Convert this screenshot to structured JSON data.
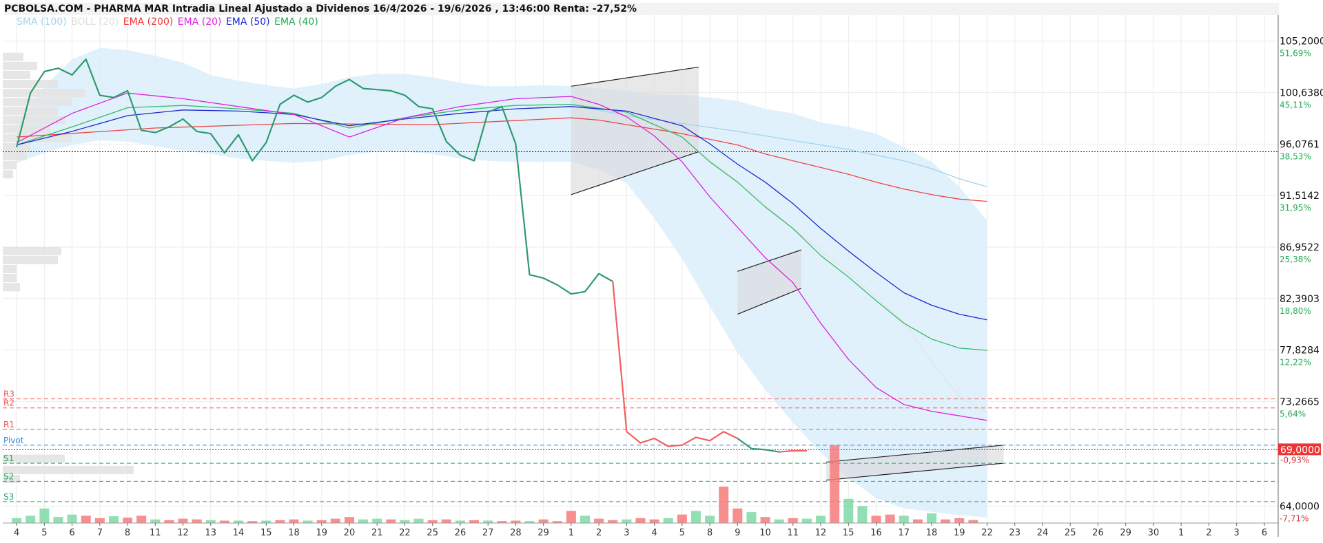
{
  "title": "PCBOLSA.COM - PHARMA MAR Intradia Lineal Ajustado a Dividenos 16/4/2026 - 19/6/2026 , 13:46:00 Renta: -27,52%",
  "legend": [
    {
      "label": "SMA (100)",
      "color": "#9fd3f0"
    },
    {
      "label": "BOLL (20)",
      "color": "#dddddd"
    },
    {
      "label": "EMA (200)",
      "color": "#ee3333"
    },
    {
      "label": "EMA (20)",
      "color": "#dd22dd"
    },
    {
      "label": "EMA (50)",
      "color": "#1a2ad0"
    },
    {
      "label": "EMA (40)",
      "color": "#22aa55"
    }
  ],
  "chart_data": {
    "type": "line",
    "ylim": [
      62.5,
      107.5
    ],
    "y_ticks": [
      {
        "value": 105.2,
        "price": "105,2000",
        "pct": "51,69%"
      },
      {
        "value": 100.638,
        "price": "100,6380",
        "pct": "45,11%"
      },
      {
        "value": 96.0761,
        "price": "96,0761",
        "pct": "38,53%"
      },
      {
        "value": 91.5142,
        "price": "91,5142",
        "pct": "31,95%"
      },
      {
        "value": 86.9522,
        "price": "86,9522",
        "pct": "25,38%"
      },
      {
        "value": 82.3903,
        "price": "82,3903",
        "pct": "18,80%"
      },
      {
        "value": 77.8284,
        "price": "77,8284",
        "pct": "12,22%"
      },
      {
        "value": 73.2665,
        "price": "73,2665",
        "pct": "5,64%"
      },
      {
        "value": 64.0,
        "price": "64,0000",
        "pct": "-7,71%"
      }
    ],
    "x_labels": [
      "4",
      "5",
      "6",
      "7",
      "8",
      "11",
      "12",
      "13",
      "14",
      "15",
      "18",
      "19",
      "20",
      "21",
      "22",
      "25",
      "26",
      "27",
      "28",
      "29",
      "1",
      "2",
      "3",
      "4",
      "5",
      "8",
      "9",
      "10",
      "11",
      "12",
      "15",
      "16",
      "17",
      "18",
      "19",
      "22",
      "23",
      "24",
      "25",
      "26",
      "29",
      "30",
      "1",
      "2",
      "3",
      "6"
    ],
    "last_price": {
      "value": 69.0,
      "label": "69,0000",
      "pct": "-0,93%"
    },
    "reference_line": 95.4,
    "pivot_levels": [
      {
        "name": "R3",
        "value": 73.5,
        "color": "#ee5555"
      },
      {
        "name": "R2",
        "value": 72.7,
        "color": "#ee5555"
      },
      {
        "name": "R1",
        "value": 70.8,
        "color": "#ee5555"
      },
      {
        "name": "Pivot",
        "value": 69.4,
        "color": "#3388dd"
      },
      {
        "name": "S1",
        "value": 67.8,
        "color": "#22aa66"
      },
      {
        "name": "S2",
        "value": 66.2,
        "color": "#22aa66"
      },
      {
        "name": "S3",
        "value": 64.4,
        "color": "#22aa66"
      }
    ],
    "series": [
      {
        "key": "price",
        "x": [
          0,
          0.5,
          1,
          1.5,
          2,
          2.5,
          3,
          3.5,
          4,
          4.5,
          5,
          5.5,
          6,
          6.5,
          7,
          7.5,
          8,
          8.5,
          9,
          9.5,
          10,
          10.5,
          11,
          11.5,
          12,
          12.5,
          13,
          13.5,
          14,
          14.5,
          15,
          15.5,
          16,
          16.5,
          17,
          17.5,
          18,
          18.5,
          19,
          19.5,
          20,
          20.5,
          21,
          21.5,
          22,
          22.5,
          23,
          23.5,
          24,
          24.5,
          25,
          25.5,
          26,
          26.5,
          27,
          27.5,
          28,
          28.5,
          29,
          29.5,
          30,
          30.5,
          31,
          31.5,
          32,
          32.5,
          33,
          33.5,
          34,
          34.5,
          35
        ],
        "values": [
          95.8,
          100.6,
          102.5,
          102.8,
          102.2,
          103.6,
          100.4,
          100.2,
          100.8,
          97.3,
          97.1,
          97.6,
          98.3,
          97.2,
          97.0,
          95.3,
          96.9,
          94.6,
          96.2,
          99.6,
          100.4,
          99.8,
          100.2,
          101.2,
          101.8,
          101.0,
          100.9,
          100.8,
          100.4,
          99.4,
          99.2,
          96.3,
          95.1,
          94.6,
          98.9,
          99.4,
          96.1,
          84.5,
          84.2,
          83.6,
          82.8,
          83.0,
          84.6,
          83.9,
          70.6,
          69.6,
          70.0,
          69.3,
          69.4,
          70.1,
          69.8,
          70.6,
          70.0,
          69.1,
          69.0,
          68.8,
          68.9,
          68.9,
          69.0,
          69.0,
          69.0,
          69.0,
          69.0,
          69.0,
          69.0,
          69.0,
          69.0,
          69.0,
          69.0,
          69.0,
          69.0
        ]
      },
      {
        "key": "ema200",
        "x": [
          0,
          5,
          10,
          15,
          20,
          21,
          22,
          23,
          24,
          25,
          26,
          27,
          28,
          29,
          30,
          31,
          32,
          33,
          34,
          35
        ],
        "values": [
          96.7,
          97.5,
          97.9,
          97.8,
          98.4,
          98.2,
          97.8,
          97.4,
          97.0,
          96.5,
          96.0,
          95.2,
          94.6,
          94.0,
          93.4,
          92.7,
          92.1,
          91.6,
          91.2,
          91.0
        ]
      },
      {
        "key": "ema20",
        "x": [
          0,
          2,
          4,
          6,
          8,
          10,
          12,
          14,
          16,
          18,
          20,
          21,
          22,
          23,
          24,
          25,
          26,
          27,
          28,
          29,
          30,
          31,
          32,
          33,
          34,
          35
        ],
        "values": [
          96.2,
          98.8,
          100.6,
          100.1,
          99.4,
          98.7,
          96.7,
          98.4,
          99.4,
          100.1,
          100.3,
          99.6,
          98.5,
          96.8,
          94.5,
          91.4,
          88.7,
          86.0,
          83.8,
          80.2,
          77.0,
          74.5,
          73.0,
          72.4,
          72.0,
          71.6
        ]
      },
      {
        "key": "ema40",
        "x": [
          0,
          2,
          4,
          6,
          8,
          10,
          12,
          14,
          16,
          18,
          20,
          22,
          24,
          25,
          26,
          27,
          28,
          29,
          30,
          31,
          32,
          33,
          34,
          35
        ],
        "values": [
          96.0,
          97.6,
          99.3,
          99.5,
          99.2,
          98.8,
          97.5,
          98.4,
          99.1,
          99.5,
          99.6,
          98.9,
          96.7,
          94.5,
          92.7,
          90.5,
          88.6,
          86.2,
          84.3,
          82.2,
          80.2,
          78.8,
          78.0,
          77.8
        ]
      },
      {
        "key": "ema50",
        "x": [
          0,
          2,
          4,
          6,
          8,
          10,
          12,
          14,
          16,
          18,
          20,
          22,
          24,
          25,
          26,
          27,
          28,
          29,
          30,
          31,
          32,
          33,
          34,
          35
        ],
        "values": [
          96.0,
          97.2,
          98.6,
          99.1,
          99.0,
          98.7,
          97.7,
          98.3,
          98.8,
          99.2,
          99.4,
          99.0,
          97.7,
          96.1,
          94.3,
          92.7,
          90.8,
          88.6,
          86.6,
          84.7,
          82.9,
          81.8,
          81.0,
          80.5
        ]
      },
      {
        "key": "sma100",
        "x": [
          20,
          22,
          24,
          26,
          28,
          30,
          32,
          33,
          34,
          35
        ],
        "values": [
          99.6,
          98.6,
          97.9,
          97.2,
          96.4,
          95.6,
          94.6,
          93.9,
          93.0,
          92.3
        ]
      },
      {
        "key": "boll_mid",
        "x": [
          20,
          22,
          24,
          26,
          28,
          30,
          32,
          33,
          34,
          35
        ],
        "values": [
          99.9,
          99.0,
          96.6,
          92.8,
          88.6,
          84.7,
          80.3,
          76.8,
          73.7,
          72.3
        ]
      },
      {
        "key": "boll_upper",
        "x": [
          0,
          1,
          2,
          3,
          4,
          5,
          6,
          7,
          8,
          9,
          10,
          11,
          12,
          13,
          14,
          15,
          16,
          17,
          18,
          19,
          20,
          21,
          22,
          23,
          24,
          25,
          26,
          27,
          28,
          29,
          30,
          31,
          32,
          33,
          34,
          35
        ],
        "values": [
          97.5,
          101.2,
          103.6,
          104.6,
          104.4,
          103.9,
          103.3,
          102.2,
          101.7,
          101.3,
          101.0,
          101.4,
          102.0,
          102.3,
          102.3,
          102.0,
          101.5,
          101.2,
          101.2,
          101.3,
          101.2,
          101.0,
          100.8,
          100.5,
          100.4,
          100.2,
          99.9,
          99.2,
          98.8,
          98.0,
          97.6,
          97.0,
          95.8,
          94.5,
          92.3,
          89.3
        ]
      },
      {
        "key": "boll_lower",
        "x": [
          0,
          1,
          2,
          3,
          4,
          5,
          6,
          7,
          8,
          9,
          10,
          11,
          12,
          13,
          14,
          15,
          16,
          17,
          18,
          19,
          20,
          21,
          22,
          23,
          24,
          25,
          26,
          27,
          28,
          29,
          30,
          31,
          32,
          33,
          34,
          35
        ],
        "values": [
          94.4,
          95.3,
          96.0,
          96.4,
          96.3,
          95.9,
          95.5,
          95.2,
          94.8,
          94.6,
          94.4,
          94.6,
          95.1,
          95.4,
          95.4,
          95.2,
          94.8,
          94.6,
          94.5,
          94.5,
          94.5,
          93.8,
          92.6,
          89.5,
          85.9,
          81.7,
          77.6,
          74.3,
          71.4,
          68.7,
          66.5,
          64.7,
          63.8,
          63.5,
          63.2,
          63.0
        ]
      }
    ],
    "volumes": [
      {
        "x": 0,
        "v": 0.2,
        "c": "g"
      },
      {
        "x": 0.5,
        "v": 0.3,
        "c": "g"
      },
      {
        "x": 1,
        "v": 0.6,
        "c": "g"
      },
      {
        "x": 1.5,
        "v": 0.25,
        "c": "g"
      },
      {
        "x": 2,
        "v": 0.35,
        "c": "g"
      },
      {
        "x": 2.5,
        "v": 0.3,
        "c": "r"
      },
      {
        "x": 3,
        "v": 0.2,
        "c": "r"
      },
      {
        "x": 3.5,
        "v": 0.28,
        "c": "g"
      },
      {
        "x": 4,
        "v": 0.22,
        "c": "r"
      },
      {
        "x": 4.5,
        "v": 0.3,
        "c": "r"
      },
      {
        "x": 5,
        "v": 0.15,
        "c": "g"
      },
      {
        "x": 5.5,
        "v": 0.12,
        "c": "r"
      },
      {
        "x": 6,
        "v": 0.18,
        "c": "r"
      },
      {
        "x": 6.5,
        "v": 0.15,
        "c": "r"
      },
      {
        "x": 7,
        "v": 0.12,
        "c": "g"
      },
      {
        "x": 7.5,
        "v": 0.1,
        "c": "r"
      },
      {
        "x": 8,
        "v": 0.1,
        "c": "g"
      },
      {
        "x": 8.5,
        "v": 0.08,
        "c": "r"
      },
      {
        "x": 9,
        "v": 0.1,
        "c": "g"
      },
      {
        "x": 9.5,
        "v": 0.12,
        "c": "r"
      },
      {
        "x": 10,
        "v": 0.15,
        "c": "r"
      },
      {
        "x": 10.5,
        "v": 0.1,
        "c": "g"
      },
      {
        "x": 11,
        "v": 0.12,
        "c": "r"
      },
      {
        "x": 11.5,
        "v": 0.18,
        "c": "r"
      },
      {
        "x": 12,
        "v": 0.25,
        "c": "r"
      },
      {
        "x": 12.5,
        "v": 0.15,
        "c": "g"
      },
      {
        "x": 13,
        "v": 0.18,
        "c": "g"
      },
      {
        "x": 13.5,
        "v": 0.15,
        "c": "r"
      },
      {
        "x": 14,
        "v": 0.12,
        "c": "g"
      },
      {
        "x": 14.5,
        "v": 0.18,
        "c": "g"
      },
      {
        "x": 15,
        "v": 0.12,
        "c": "r"
      },
      {
        "x": 15.5,
        "v": 0.15,
        "c": "r"
      },
      {
        "x": 16,
        "v": 0.1,
        "c": "g"
      },
      {
        "x": 16.5,
        "v": 0.12,
        "c": "r"
      },
      {
        "x": 17,
        "v": 0.1,
        "c": "g"
      },
      {
        "x": 17.5,
        "v": 0.08,
        "c": "r"
      },
      {
        "x": 18,
        "v": 0.1,
        "c": "r"
      },
      {
        "x": 18.5,
        "v": 0.08,
        "c": "g"
      },
      {
        "x": 19,
        "v": 0.15,
        "c": "r"
      },
      {
        "x": 19.5,
        "v": 0.08,
        "c": "r"
      },
      {
        "x": 20,
        "v": 0.5,
        "c": "r"
      },
      {
        "x": 20.5,
        "v": 0.3,
        "c": "g"
      },
      {
        "x": 21,
        "v": 0.18,
        "c": "r"
      },
      {
        "x": 21.5,
        "v": 0.12,
        "c": "r"
      },
      {
        "x": 22,
        "v": 0.15,
        "c": "g"
      },
      {
        "x": 22.5,
        "v": 0.2,
        "c": "r"
      },
      {
        "x": 23,
        "v": 0.15,
        "c": "r"
      },
      {
        "x": 23.5,
        "v": 0.2,
        "c": "g"
      },
      {
        "x": 24,
        "v": 0.35,
        "c": "r"
      },
      {
        "x": 24.5,
        "v": 0.5,
        "c": "g"
      },
      {
        "x": 25,
        "v": 0.3,
        "c": "g"
      },
      {
        "x": 25.5,
        "v": 1.5,
        "c": "r"
      },
      {
        "x": 26,
        "v": 0.6,
        "c": "r"
      },
      {
        "x": 26.5,
        "v": 0.45,
        "c": "g"
      },
      {
        "x": 27,
        "v": 0.25,
        "c": "r"
      },
      {
        "x": 27.5,
        "v": 0.15,
        "c": "g"
      },
      {
        "x": 28,
        "v": 0.2,
        "c": "r"
      },
      {
        "x": 28.5,
        "v": 0.18,
        "c": "g"
      },
      {
        "x": 29,
        "v": 0.3,
        "c": "g"
      },
      {
        "x": 29.5,
        "v": 3.2,
        "c": "r"
      },
      {
        "x": 30,
        "v": 1.0,
        "c": "g"
      },
      {
        "x": 30.5,
        "v": 0.7,
        "c": "g"
      },
      {
        "x": 31,
        "v": 0.3,
        "c": "r"
      },
      {
        "x": 31.5,
        "v": 0.35,
        "c": "r"
      },
      {
        "x": 32,
        "v": 0.3,
        "c": "g"
      },
      {
        "x": 32.5,
        "v": 0.15,
        "c": "r"
      },
      {
        "x": 33,
        "v": 0.4,
        "c": "g"
      },
      {
        "x": 33.5,
        "v": 0.15,
        "c": "r"
      },
      {
        "x": 34,
        "v": 0.2,
        "c": "r"
      },
      {
        "x": 34.5,
        "v": 0.12,
        "c": "r"
      }
    ],
    "volume_profile": [
      {
        "y": 103.8,
        "w": 30
      },
      {
        "y": 103.0,
        "w": 50
      },
      {
        "y": 102.2,
        "w": 40
      },
      {
        "y": 101.4,
        "w": 80
      },
      {
        "y": 100.6,
        "w": 120
      },
      {
        "y": 99.8,
        "w": 100
      },
      {
        "y": 99.0,
        "w": 80
      },
      {
        "y": 98.2,
        "w": 90
      },
      {
        "y": 97.4,
        "w": 70
      },
      {
        "y": 96.6,
        "w": 100
      },
      {
        "y": 95.8,
        "w": 40
      },
      {
        "y": 95.0,
        "w": 35
      },
      {
        "y": 94.2,
        "w": 20
      },
      {
        "y": 93.4,
        "w": 15
      },
      {
        "y": 86.6,
        "w": 85
      },
      {
        "y": 85.8,
        "w": 80
      },
      {
        "y": 85.0,
        "w": 20
      },
      {
        "y": 84.2,
        "w": 20
      },
      {
        "y": 83.4,
        "w": 25
      },
      {
        "y": 68.2,
        "w": 90
      },
      {
        "y": 67.2,
        "w": 190
      },
      {
        "y": 66.4,
        "w": 25
      }
    ],
    "shaded_channels": [
      {
        "x0": 20,
        "x1": 24.6,
        "top": [
          101.2,
          102.9
        ],
        "bottom": [
          91.6,
          95.4
        ]
      },
      {
        "x0": 26,
        "x1": 28.3,
        "top": [
          84.8,
          86.7
        ],
        "bottom": [
          81.0,
          83.3
        ]
      },
      {
        "x0": 29.2,
        "x1": 35.6,
        "top": [
          67.9,
          69.4
        ],
        "bottom": [
          66.3,
          67.8
        ]
      }
    ]
  }
}
